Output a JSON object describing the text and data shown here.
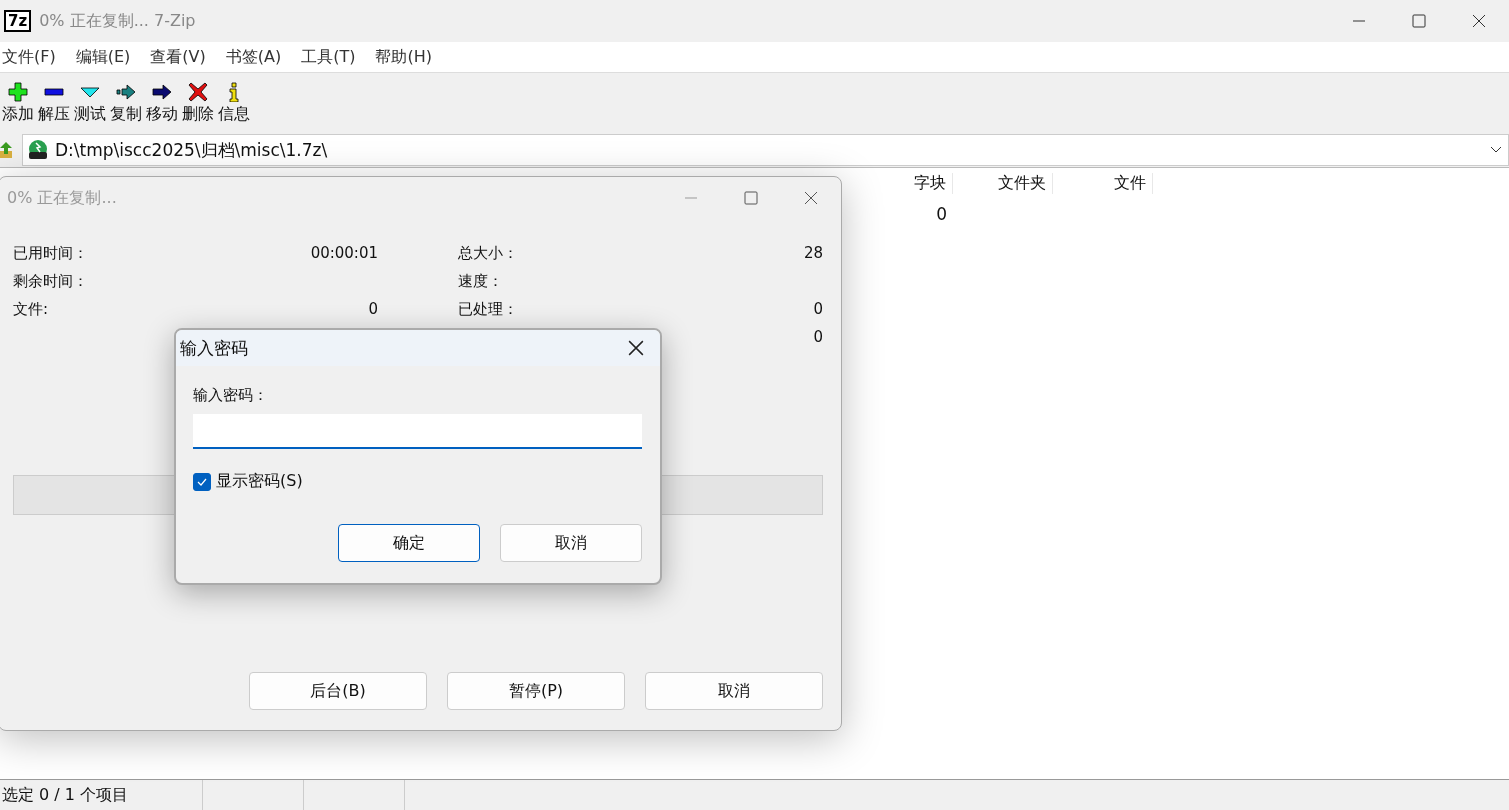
{
  "window": {
    "icon_text": "7z",
    "title": "0% 正在复制... 7-Zip"
  },
  "menu": [
    "文件(F)",
    "编辑(E)",
    "查看(V)",
    "书签(A)",
    "工具(T)",
    "帮助(H)"
  ],
  "toolbar": [
    {
      "label": "添加",
      "kind": "plus"
    },
    {
      "label": "解压",
      "kind": "minus"
    },
    {
      "label": "测试",
      "kind": "check"
    },
    {
      "label": "复制",
      "kind": "copy"
    },
    {
      "label": "移动",
      "kind": "move"
    },
    {
      "label": "删除",
      "kind": "delete"
    },
    {
      "label": "信息",
      "kind": "info"
    }
  ],
  "address": {
    "path": "D:\\tmp\\iscc2025\\归档\\misc\\1.7z\\"
  },
  "table": {
    "columns": [
      "字块",
      "文件夹",
      "文件"
    ],
    "rows": [
      [
        "0",
        "",
        ""
      ]
    ]
  },
  "status_bar": [
    "选定 0 / 1 个项目"
  ],
  "progress_dialog": {
    "title": "0% 正在复制...",
    "left_stats": [
      {
        "label": "已用时间：",
        "value": "00:00:01"
      },
      {
        "label": "剩余时间："
      },
      {
        "label": "文件:",
        "value": "0"
      }
    ],
    "right_stats": [
      {
        "label": "总大小：",
        "value": "28"
      },
      {
        "label": "速度："
      },
      {
        "label": "已处理：",
        "value": "0"
      },
      {
        "value": "0"
      }
    ],
    "progress": {
      "level": 0
    },
    "buttons": [
      "后台(B)",
      "暂停(P)",
      "取消"
    ]
  },
  "password_dialog": {
    "title": "输入密码",
    "label": "输入密码：",
    "show_password": {
      "label": "显示密码(S)",
      "checked": true
    },
    "buttons": [
      {
        "label": "确定",
        "default": true
      },
      {
        "label": "取消",
        "default": false
      }
    ]
  }
}
